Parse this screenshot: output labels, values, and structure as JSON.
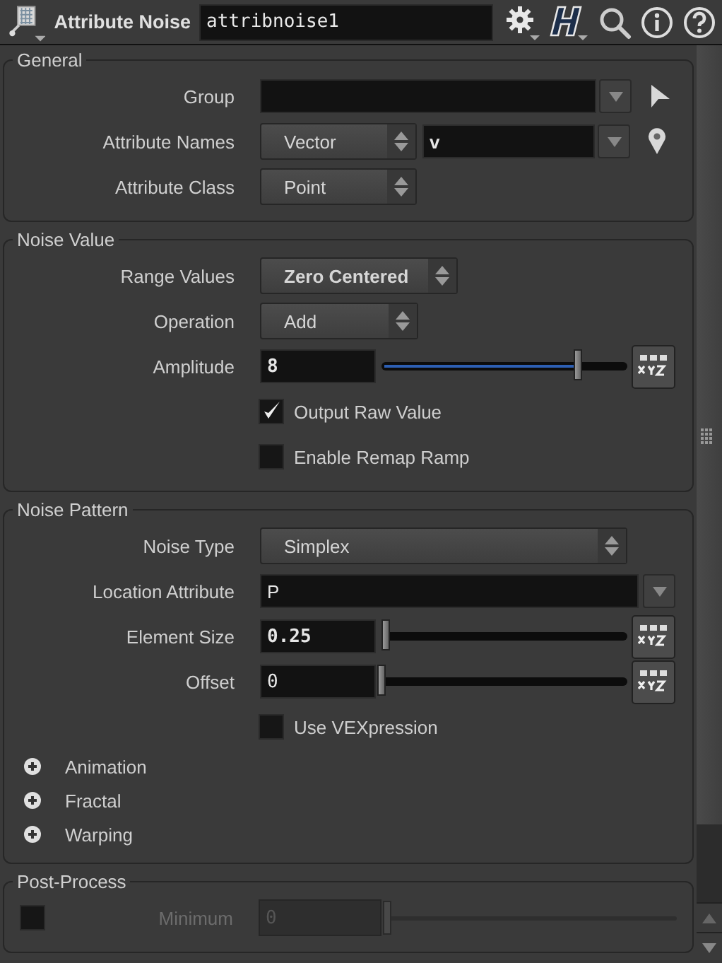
{
  "header": {
    "node_type": "Attribute Noise",
    "node_name": "attribnoise1"
  },
  "sections": [
    {
      "title": "General",
      "rows": [
        {
          "kind": "group",
          "label": "Group"
        },
        {
          "kind": "attrib",
          "label": "Attribute Names",
          "menu": "Vector",
          "value": "v",
          "changed": true
        },
        {
          "kind": "menu",
          "label": "Attribute Class",
          "value": "Point",
          "changed": false
        }
      ]
    },
    {
      "title": "Noise Value",
      "rows": [
        {
          "kind": "menu",
          "label": "Range Values",
          "value": "Zero Centered",
          "changed": true
        },
        {
          "kind": "menu",
          "label": "Operation",
          "value": "Add",
          "changed": false
        },
        {
          "kind": "slider",
          "label": "Amplitude",
          "value": "8",
          "changed": true,
          "level": 0.8
        },
        {
          "kind": "checkbox",
          "label": "Output Raw Value",
          "checked": true
        },
        {
          "kind": "checkbox",
          "label": "Enable Remap Ramp",
          "checked": false
        }
      ]
    },
    {
      "title": "Noise Pattern",
      "rows": [
        {
          "kind": "menu",
          "label": "Noise Type",
          "value": "Simplex",
          "changed": false
        },
        {
          "kind": "string",
          "label": "Location Attribute",
          "value": "P",
          "changed": false
        },
        {
          "kind": "slider",
          "label": "Element Size",
          "value": "0.25",
          "changed": true,
          "level": 0.02
        },
        {
          "kind": "slider",
          "label": "Offset",
          "value": "0",
          "changed": false,
          "level": 0
        },
        {
          "kind": "checkbox",
          "label": "Use VEXpression",
          "checked": false
        },
        {
          "kind": "folder",
          "label": "Animation",
          "expanded": false
        },
        {
          "kind": "folder",
          "label": "Fractal",
          "expanded": false
        },
        {
          "kind": "folder",
          "label": "Warping",
          "expanded": false
        }
      ]
    },
    {
      "title": "Post-Process",
      "rows": [
        {
          "kind": "toggle_slider",
          "label": "Minimum",
          "value": "0",
          "checked": false,
          "disabled": true,
          "level": 0
        }
      ]
    }
  ]
}
